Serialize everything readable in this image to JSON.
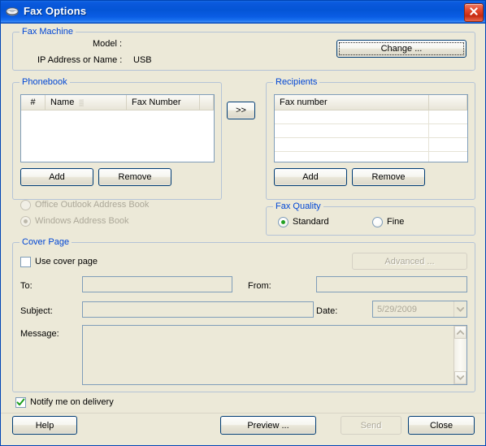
{
  "window": {
    "title": "Fax Options",
    "icon": "fax-machine-icon",
    "close_label": "Close window",
    "background_color": "#ece9d8",
    "titlebar_color": "#0a58db",
    "group_title_color": "#0046d5"
  },
  "fax_machine": {
    "group_title": "Fax Machine",
    "model_label": "Model :",
    "model_value": "",
    "ip_label": "IP Address or Name :",
    "ip_value": "USB",
    "change_button": "Change ...",
    "change_button_focused": true
  },
  "phonebook": {
    "group_title": "Phonebook",
    "columns": [
      "#",
      "Name",
      "Fax Number"
    ],
    "sort_column": "Name",
    "sort_indicator": "▒",
    "rows": [],
    "add_button": "Add",
    "remove_button": "Remove",
    "address_book_options": [
      {
        "label": "Office Outlook Address Book",
        "selected": false,
        "enabled": false
      },
      {
        "label": "Windows Address Book",
        "selected": true,
        "enabled": false
      }
    ]
  },
  "transfer": {
    "button_label": ">>"
  },
  "recipients": {
    "group_title": "Recipients",
    "columns": [
      "Fax number",
      ""
    ],
    "rows": [],
    "empty_row_count": 5,
    "add_button": "Add",
    "remove_button": "Remove"
  },
  "fax_quality": {
    "group_title": "Fax Quality",
    "options": [
      {
        "label": "Standard",
        "selected": true
      },
      {
        "label": "Fine",
        "selected": false
      }
    ]
  },
  "cover_page": {
    "group_title": "Cover Page",
    "use_cover_page_label": "Use cover page",
    "use_cover_page_checked": false,
    "advanced_button": "Advanced ...",
    "advanced_enabled": false,
    "to_label": "To:",
    "to_value": "",
    "from_label": "From:",
    "from_value": "",
    "subject_label": "Subject:",
    "subject_value": "",
    "date_label": "Date:",
    "date_value": "5/29/2009",
    "message_label": "Message:",
    "message_value": ""
  },
  "footer": {
    "notify_label": "Notify me on delivery",
    "notify_checked": true,
    "help_button": "Help",
    "preview_button": "Preview ...",
    "send_button": "Send",
    "send_enabled": false,
    "close_button": "Close"
  }
}
